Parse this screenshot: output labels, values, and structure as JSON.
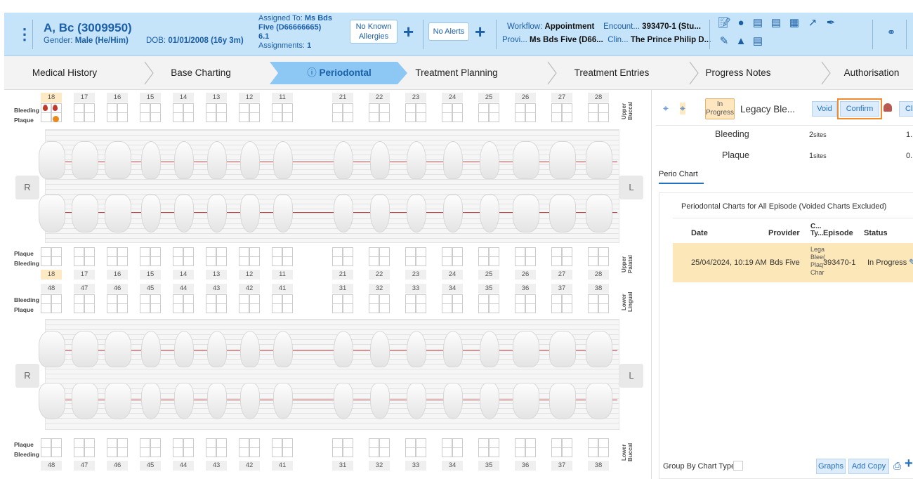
{
  "patient": {
    "name": "A, Bc (3009950)",
    "gender_label": "Gender:",
    "gender": "Male (He/Him)",
    "dob_label": "DOB:",
    "dob": "01/01/2008 (16y 3m)"
  },
  "assignment": {
    "label": "Assigned To:",
    "name_line1": "Ms Bds",
    "name_line2": "Five (D66666665)",
    "line3": "6.1",
    "count_label": "Assignments:",
    "count": "1"
  },
  "allergies": {
    "line1": "No Known",
    "line2": "Allergies"
  },
  "alerts": "No Alerts",
  "workflow": {
    "label": "Workflow:",
    "value": "Appointment",
    "enc_label": "Encount...",
    "enc_value": "393470-1 (Stu...",
    "prov_label": "Provi...",
    "prov_value": "Ms Bds Five (D66...",
    "clin_label": "Clin...",
    "clin_value": "The Prince Philip D..."
  },
  "header_icons": [
    "edit-note-icon",
    "person-icon",
    "clipboard-icon",
    "document-icon",
    "calendar-table-icon",
    "running-person-icon",
    "pen-icon",
    "edit-document-icon",
    "graduation-cap-icon",
    "file-icon",
    "handshake-icon"
  ],
  "nav": {
    "steps": [
      "Medical History",
      "Base Charting",
      "Periodontal",
      "Treatment Planning",
      "Treatment Entries",
      "Progress Notes",
      "Authorisation"
    ],
    "active_icon": "ⓘ"
  },
  "chart": {
    "upper_teeth": [
      "18",
      "17",
      "16",
      "15",
      "14",
      "13",
      "12",
      "11",
      "21",
      "22",
      "23",
      "24",
      "25",
      "26",
      "27",
      "28"
    ],
    "lower_teeth": [
      "48",
      "47",
      "46",
      "45",
      "44",
      "43",
      "42",
      "41",
      "31",
      "32",
      "33",
      "34",
      "35",
      "36",
      "37",
      "38"
    ],
    "labels": {
      "bleeding": "Bleeding",
      "plaque": "Plaque",
      "upper_buccal": "Upper Buccal",
      "upper_palatal": "Upper Palatal",
      "lower_lingual": "Lower Lingual",
      "lower_buccal": "Lower Buccal",
      "right": "R",
      "left": "L"
    },
    "highlight_tooth": "18",
    "bleeding_color": "#c0392b",
    "plaque_color": "#e8891a"
  },
  "summary": {
    "status_line1": "In",
    "status_line2": "Progress",
    "title": "Legacy Ble...",
    "void": "Void",
    "confirm": "Confirm",
    "cl": "Cl",
    "rows": [
      {
        "label": "Bleeding",
        "count": "2",
        "unit": "sites",
        "pct": "1."
      },
      {
        "label": "Plaque",
        "count": "1",
        "unit": "sites",
        "pct": "0."
      }
    ]
  },
  "perio": {
    "tab": "Perio Chart",
    "panel_title": "Periodontal Charts for All Episode (Voided Charts Excluded)",
    "columns": [
      "Date",
      "Provider",
      "C...",
      "Ty...",
      "Episode",
      "Status"
    ],
    "row": {
      "date": "25/04/2024, 10:19 AM",
      "provider": "Bds Five",
      "type_lines": [
        "Lega",
        "Blee(",
        "Plaq",
        "Char"
      ],
      "episode": "393470-1",
      "status": "In Progress"
    }
  },
  "footer": {
    "group_label": "Group By Chart Type",
    "graphs": "Graphs",
    "add_copy": "Add Copy"
  },
  "colors": {
    "accent": "#1a5fa8",
    "header_bg": "#c5e3f9",
    "active_step": "#8cc8f3",
    "confirm_outline": "#f08c2e",
    "row_highlight": "#fbe7b8"
  }
}
